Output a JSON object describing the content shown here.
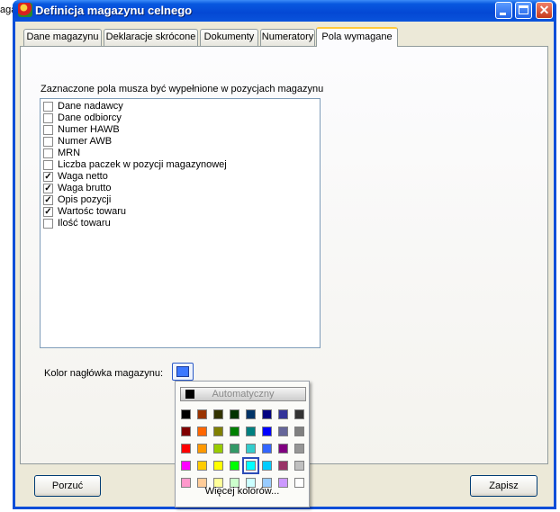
{
  "background_fragment": "aga",
  "window": {
    "title": "Definicja magazynu celnego",
    "close_glyph": "✕"
  },
  "tabs": [
    {
      "label": "Dane magazynu",
      "active": false
    },
    {
      "label": "Deklaracje skrócone",
      "active": false
    },
    {
      "label": "Dokumenty",
      "active": false
    },
    {
      "label": "Numeratory",
      "active": false
    },
    {
      "label": "Pola wymagane",
      "active": true
    }
  ],
  "required_fields": {
    "instruction": "Zaznaczone pola musza być wypełnione w pozycjach magazynu",
    "check_glyph": "✓",
    "items": [
      {
        "label": "Dane nadawcy",
        "checked": false
      },
      {
        "label": "Dane odbiorcy",
        "checked": false
      },
      {
        "label": "Numer HAWB",
        "checked": false
      },
      {
        "label": "Numer AWB",
        "checked": false
      },
      {
        "label": "MRN",
        "checked": false
      },
      {
        "label": "Liczba paczek w pozycji magazynowej",
        "checked": false
      },
      {
        "label": "Waga netto",
        "checked": true
      },
      {
        "label": "Waga brutto",
        "checked": true
      },
      {
        "label": "Opis pozycji",
        "checked": true
      },
      {
        "label": "Wartośc towaru",
        "checked": true
      },
      {
        "label": "Ilość towaru",
        "checked": false
      }
    ]
  },
  "header_color": {
    "label": "Kolor nagłówka magazynu:",
    "selected_color": "#3c78ff"
  },
  "palette": {
    "auto_label": "Automatyczny",
    "more_label": "Więcej kolorów...",
    "selected": [
      3,
      4
    ],
    "rows": [
      [
        "#000000",
        "#993300",
        "#333300",
        "#003300",
        "#003366",
        "#000080",
        "#333399",
        "#333333"
      ],
      [
        "#800000",
        "#ff6600",
        "#808000",
        "#008000",
        "#008080",
        "#0000ff",
        "#666699",
        "#808080"
      ],
      [
        "#ff0000",
        "#ff9900",
        "#99cc00",
        "#339966",
        "#33cccc",
        "#3366ff",
        "#800080",
        "#969696"
      ],
      [
        "#ff00ff",
        "#ffcc00",
        "#ffff00",
        "#00ff00",
        "#00ffff",
        "#00ccff",
        "#993366",
        "#c0c0c0"
      ],
      [
        "#ff99cc",
        "#ffcc99",
        "#ffff99",
        "#ccffcc",
        "#ccffff",
        "#99ccff",
        "#cc99ff",
        "#ffffff"
      ]
    ]
  },
  "buttons": {
    "cancel": "Porzuć",
    "save": "Zapisz"
  }
}
